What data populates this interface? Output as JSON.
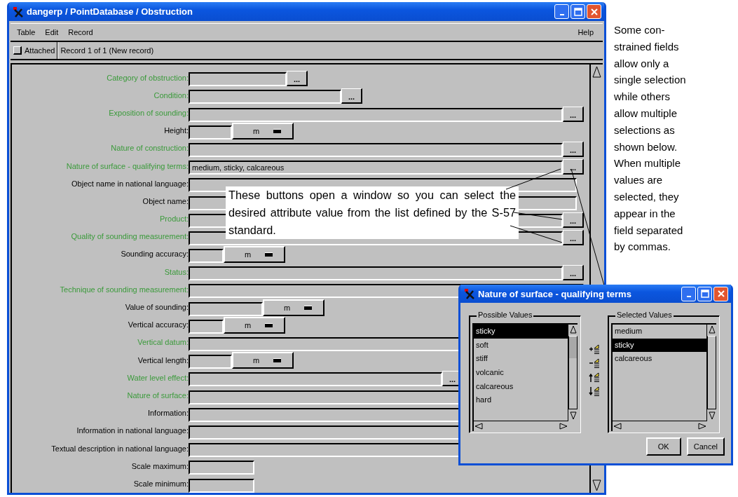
{
  "window": {
    "title": "dangerp / PointDatabase / Obstruction"
  },
  "menu": [
    {
      "label": "Table"
    },
    {
      "label": "Edit"
    },
    {
      "label": "Record"
    }
  ],
  "help_menu": "Help",
  "record_bar": {
    "attached_label": "Attached",
    "attached_checked": false,
    "record_status": "Record 1 of 1 (New record)"
  },
  "fields": [
    {
      "label": "Category of obstruction:",
      "required": true,
      "kind": "picklist",
      "button": "..."
    },
    {
      "label": "Condition:",
      "required": true,
      "kind": "picklist",
      "button": "..."
    },
    {
      "label": "Exposition of sounding:",
      "required": true,
      "kind": "picklist",
      "button": "..."
    },
    {
      "label": "Height:",
      "required": false,
      "kind": "measure",
      "unit": "m"
    },
    {
      "label": "Nature of construction:",
      "required": true,
      "kind": "picklist",
      "button": "..."
    },
    {
      "label": "Nature of surface - qualifying terms:",
      "required": true,
      "kind": "picklist",
      "value": "medium, sticky, calcareous",
      "button": "..."
    },
    {
      "label": "Object name in national language:",
      "required": false,
      "kind": "text"
    },
    {
      "label": "Object name:",
      "required": false,
      "kind": "text"
    },
    {
      "label": "Product:",
      "required": true,
      "kind": "picklist",
      "button": "..."
    },
    {
      "label": "Quality of sounding measurement:",
      "required": true,
      "kind": "picklist",
      "button": "..."
    },
    {
      "label": "Sounding accuracy:",
      "required": false,
      "kind": "measure",
      "unit": "m"
    },
    {
      "label": "Status:",
      "required": true,
      "kind": "picklist",
      "button": "..."
    },
    {
      "label": "Technique of sounding measurement:",
      "required": true,
      "kind": "text"
    },
    {
      "label": "Value of sounding:",
      "required": false,
      "kind": "measure",
      "unit": "m"
    },
    {
      "label": "Vertical accuracy:",
      "required": false,
      "kind": "measure",
      "unit": "m"
    },
    {
      "label": "Vertical datum:",
      "required": true,
      "kind": "text"
    },
    {
      "label": "Vertical length:",
      "required": false,
      "kind": "measure",
      "unit": "m"
    },
    {
      "label": "Water level effect:",
      "required": true,
      "kind": "picklist",
      "button": "..."
    },
    {
      "label": "Nature of surface:",
      "required": true,
      "kind": "text"
    },
    {
      "label": "Information:",
      "required": false,
      "kind": "text"
    },
    {
      "label": "Information in national language:",
      "required": false,
      "kind": "text"
    },
    {
      "label": "Textual description in national language:",
      "required": false,
      "kind": "text"
    },
    {
      "label": "Scale maximum:",
      "required": false,
      "kind": "text"
    },
    {
      "label": "Scale minimum:",
      "required": false,
      "kind": "text"
    }
  ],
  "callout": "These buttons open a window so you can select the desired attribute value from the list defined by the S-57 standard.",
  "side_note": [
    "Some con-",
    "strained fields",
    "allow only a",
    "single selection",
    "while others",
    "allow multiple",
    "selections as",
    "shown below.",
    "When multiple",
    "values are",
    "selected, they",
    "appear in the",
    "field separated",
    "by commas."
  ],
  "dialog": {
    "title": "Nature of surface - qualifying terms",
    "possible": {
      "title": "Possible Values",
      "items": [
        {
          "label": "sticky",
          "selected": true
        },
        {
          "label": "soft",
          "selected": false
        },
        {
          "label": "stiff",
          "selected": false
        },
        {
          "label": "volcanic",
          "selected": false
        },
        {
          "label": "calcareous",
          "selected": false
        },
        {
          "label": "hard",
          "selected": false
        }
      ]
    },
    "chosen": {
      "title": "Selected Values",
      "items": [
        {
          "label": "medium",
          "selected": false
        },
        {
          "label": "sticky",
          "selected": true
        },
        {
          "label": "calcareous",
          "selected": false
        }
      ]
    },
    "buttons": [
      "OK",
      "Cancel"
    ]
  }
}
